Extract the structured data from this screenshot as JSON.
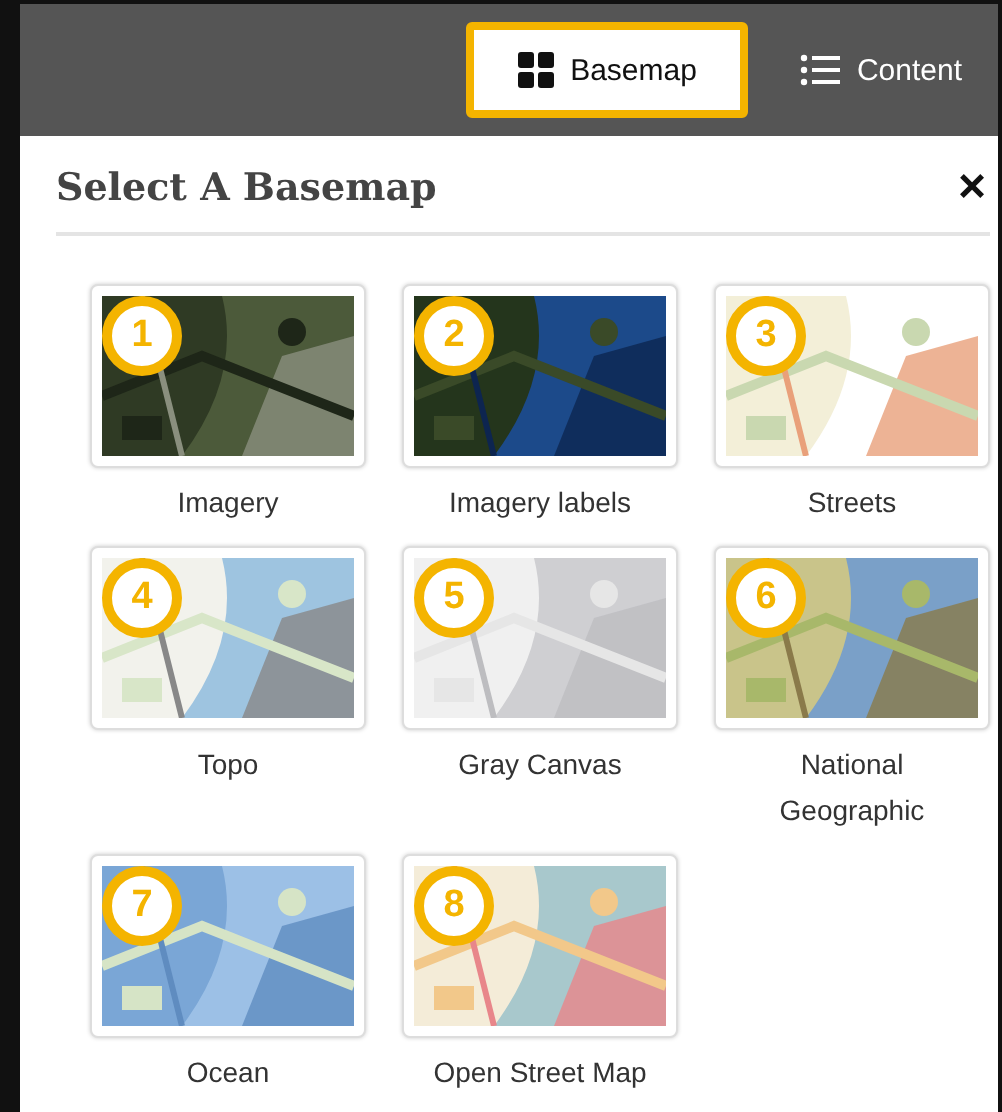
{
  "tabs": [
    {
      "label": "Basemap",
      "kind": "grid",
      "selected": true
    },
    {
      "label": "Content",
      "kind": "list",
      "selected": false
    }
  ],
  "panel": {
    "title": "Select A Basemap",
    "close": "×"
  },
  "basemaps": [
    {
      "badge": "1",
      "label": "Imagery"
    },
    {
      "badge": "2",
      "label": "Imagery labels"
    },
    {
      "badge": "3",
      "label": "Streets"
    },
    {
      "badge": "4",
      "label": "Topo"
    },
    {
      "badge": "5",
      "label": "Gray Canvas"
    },
    {
      "badge": "6",
      "label": "National Geographic"
    },
    {
      "badge": "7",
      "label": "Ocean"
    },
    {
      "badge": "8",
      "label": "Open Street Map"
    }
  ]
}
